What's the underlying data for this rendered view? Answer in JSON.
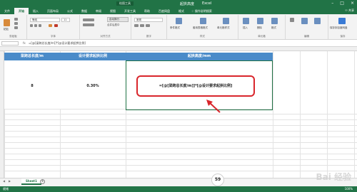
{
  "window": {
    "context_tab": "绘图工具",
    "file_name": "起拱高度",
    "app_name": "Excel",
    "share": "共享"
  },
  "menu": {
    "tabs": [
      "文件",
      "开始",
      "插入",
      "页面布局",
      "公式",
      "数据",
      "审阅",
      "视图",
      "开发工具",
      "帮助",
      "百度网盘",
      "格式"
    ],
    "active_tab": "开始",
    "tell_me": "操作说明搜索"
  },
  "ribbon": {
    "clipboard": "剪贴板",
    "paste": "粘贴",
    "font_name": "等线",
    "font_size": "11",
    "font_group": "字体",
    "align_group": "对齐方式",
    "wrap_text": "自动换行",
    "merge_center": "合并后居中",
    "number_format": "常规",
    "number_group": "数字",
    "cond_format": "条件格式",
    "table_format": "套用表格格式",
    "cell_style": "单元格样式",
    "styles_group": "样式",
    "insert": "插入",
    "delete": "删除",
    "format": "格式",
    "cells_group": "单元格",
    "edit_group": "编辑",
    "save_cloud": "保存到百度网盘",
    "save_group": "保存"
  },
  "formula_bar": {
    "fx": "fx",
    "formula": "=[@[梁跨总长度/m]]*[@设计要求起拱比例]"
  },
  "table": {
    "headers": [
      "梁跨总长度/m",
      "设计要求起拱比例",
      "起拱高度/mm"
    ],
    "row": [
      "8",
      "0.30%",
      "=[@[梁跨总长度/m]]*[@设计要求起拱比例]"
    ]
  },
  "sheet": {
    "tab": "Sheet1",
    "add": "+"
  },
  "status": {
    "left": "就绪",
    "right": "100%"
  },
  "overlay": {
    "timer": "59",
    "watermark": "Bai 经验"
  }
}
